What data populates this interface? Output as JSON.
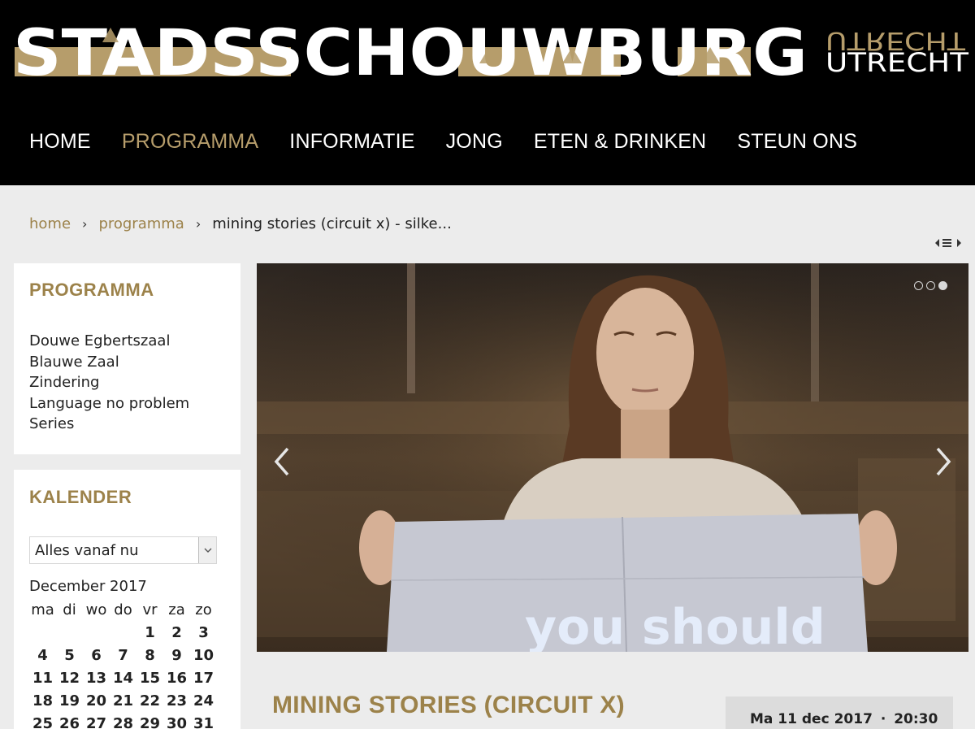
{
  "header": {
    "logo_text": "STADSSCHOUWBURG",
    "logo_city": "UTRECHT"
  },
  "nav": {
    "items": [
      {
        "label": "HOME",
        "active": false
      },
      {
        "label": "PROGRAMMA",
        "active": true
      },
      {
        "label": "INFORMATIE",
        "active": false
      },
      {
        "label": "JONG",
        "active": false
      },
      {
        "label": "ETEN & DRINKEN",
        "active": false
      },
      {
        "label": "STEUN ONS",
        "active": false
      }
    ]
  },
  "breadcrumb": {
    "home": "home",
    "programma": "programma",
    "current": "mining stories (circuit x) - silke..."
  },
  "sidebar": {
    "programma": {
      "title": "PROGRAMMA",
      "items": [
        "Douwe Egbertszaal",
        "Blauwe Zaal",
        "Zindering",
        "Language no problem",
        "Series"
      ]
    },
    "kalender": {
      "title": "KALENDER",
      "select_value": "Alles vanaf nu",
      "month": "December 2017",
      "weekdays": [
        "ma",
        "di",
        "wo",
        "do",
        "vr",
        "za",
        "zo"
      ],
      "weeks": [
        [
          "",
          "",
          "",
          "",
          "1",
          "2",
          "3"
        ],
        [
          "4",
          "5",
          "6",
          "7",
          "8",
          "9",
          "10"
        ],
        [
          "11",
          "12",
          "13",
          "14",
          "15",
          "16",
          "17"
        ],
        [
          "18",
          "19",
          "20",
          "21",
          "22",
          "23",
          "24"
        ],
        [
          "25",
          "26",
          "27",
          "28",
          "29",
          "30",
          "31"
        ]
      ]
    }
  },
  "hero": {
    "sign_text": "you should",
    "slide_count": 3,
    "active_slide": 3
  },
  "event": {
    "title": "MINING STORIES (CIRCUIT X)",
    "date": "Ma 11 dec 2017",
    "time": "20:30",
    "date_separator": "·"
  },
  "colors": {
    "gold": "#9c824a",
    "nav_active": "#b69d6b",
    "header_bg": "#000000",
    "page_bg": "#ececec"
  }
}
